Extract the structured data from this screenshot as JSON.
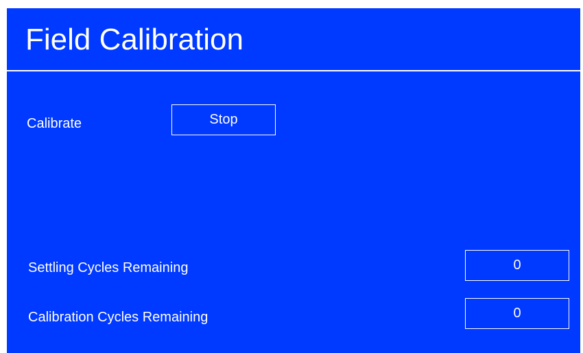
{
  "header": {
    "title": "Field Calibration"
  },
  "calibrate": {
    "label": "Calibrate",
    "button_label": "Stop"
  },
  "settling": {
    "label": "Settling Cycles Remaining",
    "value": "0"
  },
  "calibration": {
    "label": "Calibration Cycles Remaining",
    "value": "0"
  },
  "colors": {
    "background": "#0039ff",
    "foreground": "#ffffff"
  }
}
